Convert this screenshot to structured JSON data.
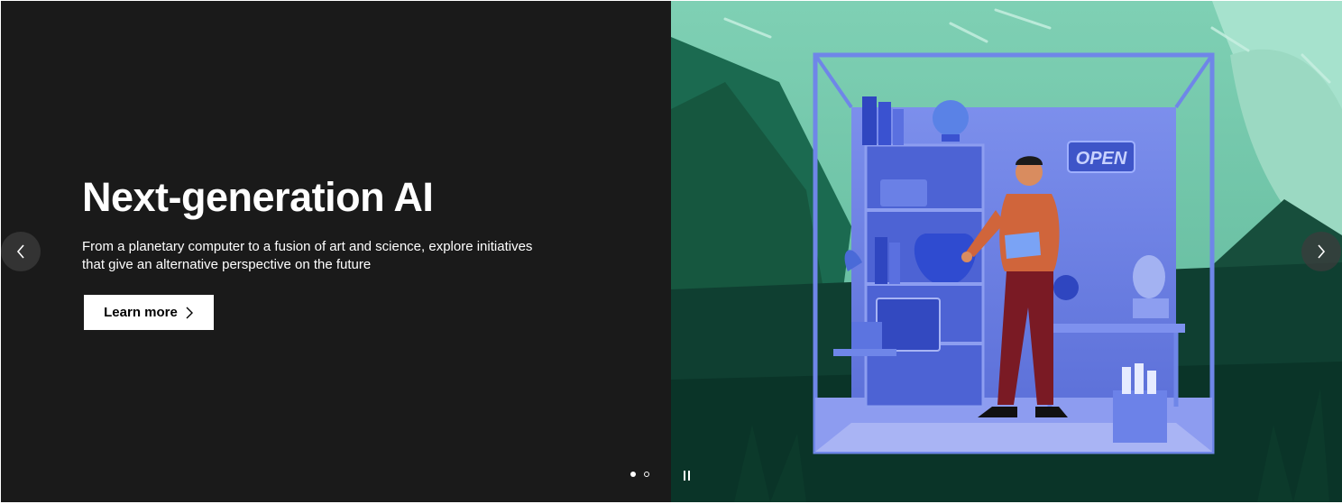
{
  "hero": {
    "title": "Next-generation AI",
    "description": "From a planetary computer to a fusion of art and science, explore initiatives that give an alternative perspective on the future",
    "cta_label": "Learn more",
    "illustration_sign": "OPEN",
    "colors": {
      "panel_bg": "#1a1a1a",
      "text": "#ffffff",
      "cta_bg": "#ffffff",
      "cta_text": "#000000",
      "accent_blue": "#6f86e8",
      "mountain_green": "#1f6e55"
    }
  },
  "carousel": {
    "slide_count": 2,
    "active_slide": 1,
    "prev_icon": "chevron-left-icon",
    "next_icon": "chevron-right-icon",
    "pause_icon": "pause-icon"
  }
}
